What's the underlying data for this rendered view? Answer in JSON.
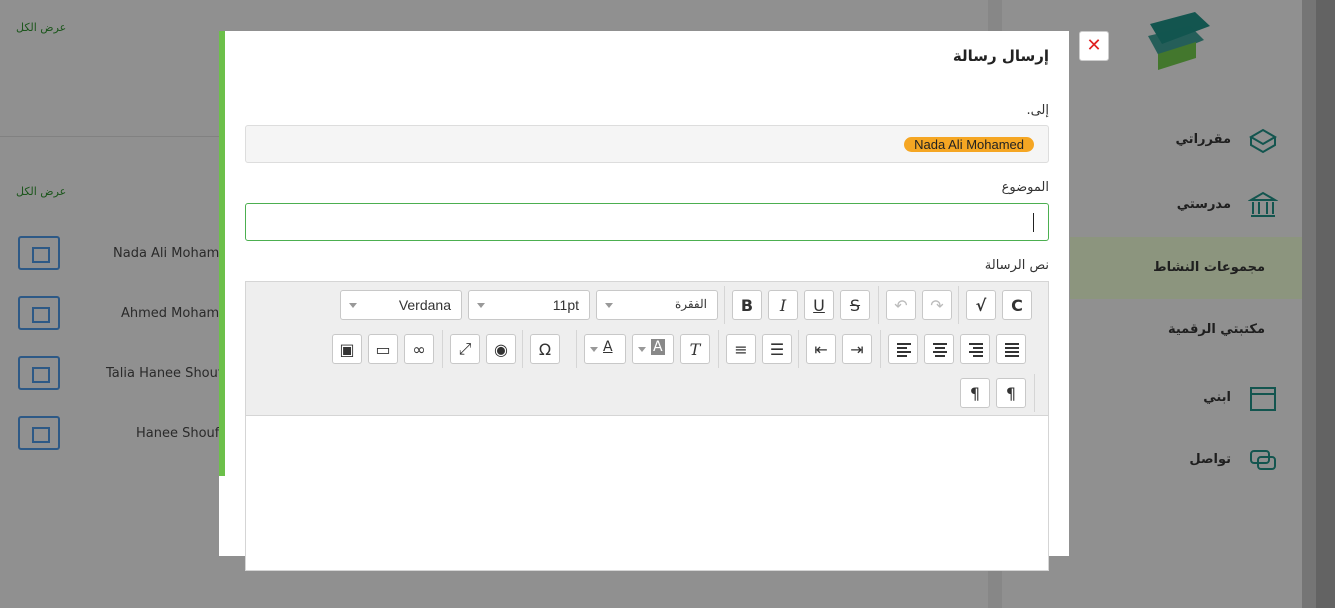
{
  "background": {
    "sidebar": {
      "items": [
        {
          "label": "مقرراتي",
          "icon": "book-icon"
        },
        {
          "label": "مدرستي",
          "icon": "school-icon"
        },
        {
          "label": "مجموعات النشاط",
          "icon": ""
        },
        {
          "label": "مكتبتي الرقمية",
          "icon": ""
        },
        {
          "label": "ابني",
          "icon": "calendar-icon"
        },
        {
          "label": "تواصل",
          "icon": "chat-icon"
        }
      ]
    },
    "header_links": [
      "عرض الكل",
      "عرض الكل"
    ],
    "contacts": [
      "Nada Ali Mohame",
      "Ahmed Mohame",
      "Talia Hanee Shoufi",
      "Hanee Shoufi"
    ]
  },
  "modal": {
    "title": "إرسال رسالة",
    "to_label": "إلى.",
    "recipient": "Nada Ali Mohamed",
    "subject_label": "الموضوع",
    "subject_value": "",
    "body_label": "نص الرسالة",
    "close_symbol": "✕",
    "toolbar": {
      "font_family": "Verdana",
      "font_size": "11pt",
      "block_format": "الفقرة"
    }
  },
  "colors": {
    "accent_green": "#6cc04a",
    "tag_orange": "#f5a623",
    "close_red": "#e02020"
  }
}
